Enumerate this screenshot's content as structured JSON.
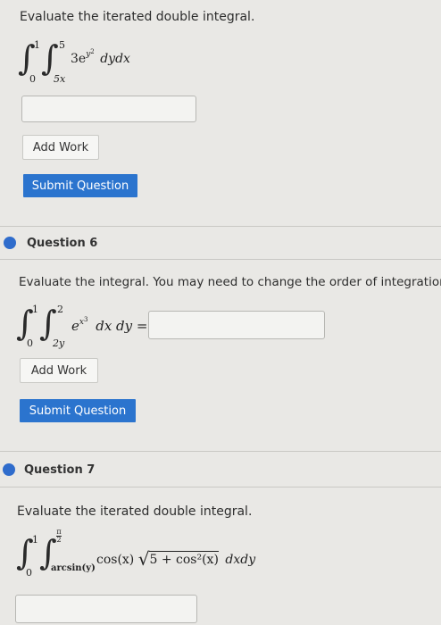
{
  "q5": {
    "prompt": "Evaluate the iterated double integral.",
    "limits": {
      "outer_lower": "0",
      "outer_upper": "1",
      "inner_lower": "5x",
      "inner_upper": "5"
    },
    "integrand": "3e",
    "exponent": "y",
    "exponent_power": "2",
    "differential": "dydx",
    "buttons": {
      "add_work": "Add Work",
      "submit": "Submit Question"
    }
  },
  "q6": {
    "title": "Question 6",
    "prompt": "Evaluate the integral. You may need to change the order of integration.",
    "limits": {
      "outer_lower": "0",
      "outer_upper": "1",
      "inner_lower": "2y",
      "inner_upper": "2"
    },
    "integrand": "e",
    "exponent": "x",
    "exponent_power": "3",
    "differential": "dx dy =",
    "buttons": {
      "add_work": "Add Work",
      "submit": "Submit Question"
    }
  },
  "q7": {
    "title": "Question 7",
    "prompt": "Evaluate the iterated double integral.",
    "limits": {
      "outer_lower": "0",
      "outer_upper": "1",
      "inner_lower": "arcsin(y)",
      "inner_upper_num": "π",
      "inner_upper_den": "2"
    },
    "integrand_left": "cos(x)",
    "radicand": "5 + cos²(x)",
    "differential": "dxdy"
  },
  "colors": {
    "accent": "#2b74ce",
    "bullet": "#2f6ccc",
    "background": "#e9e8e5"
  }
}
